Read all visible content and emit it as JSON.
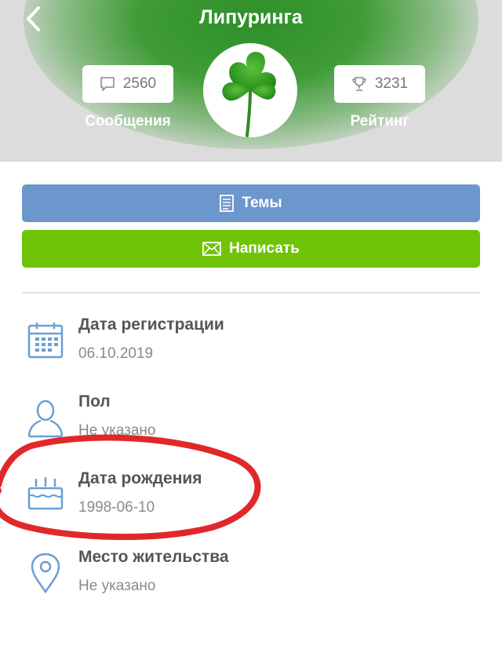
{
  "header": {
    "title": "Липуринга",
    "back_icon": "chevron-left-icon",
    "messages": {
      "count": "2560",
      "label": "Сообщения",
      "icon": "message-icon"
    },
    "rating": {
      "count": "3231",
      "label": "Рейтинг",
      "icon": "trophy-icon"
    },
    "avatar_icon": "clover-icon"
  },
  "actions": {
    "topics_label": "Темы",
    "write_label": "Написать"
  },
  "profile": {
    "items": [
      {
        "label": "Дата регистрации",
        "value": "06.10.2019",
        "icon": "calendar-icon"
      },
      {
        "label": "Пол",
        "value": "Не указано",
        "icon": "person-icon"
      },
      {
        "label": "Дата рождения",
        "value": "1998-06-10",
        "icon": "cake-icon"
      },
      {
        "label": "Место жительства",
        "value": "Не указано",
        "icon": "location-pin-icon"
      }
    ]
  },
  "colors": {
    "header_green": "#3f9c36",
    "topics_button": "#6c97cd",
    "write_button": "#6fc408",
    "icon_blue": "#6a9fd3",
    "highlight_red": "#e0282b"
  }
}
